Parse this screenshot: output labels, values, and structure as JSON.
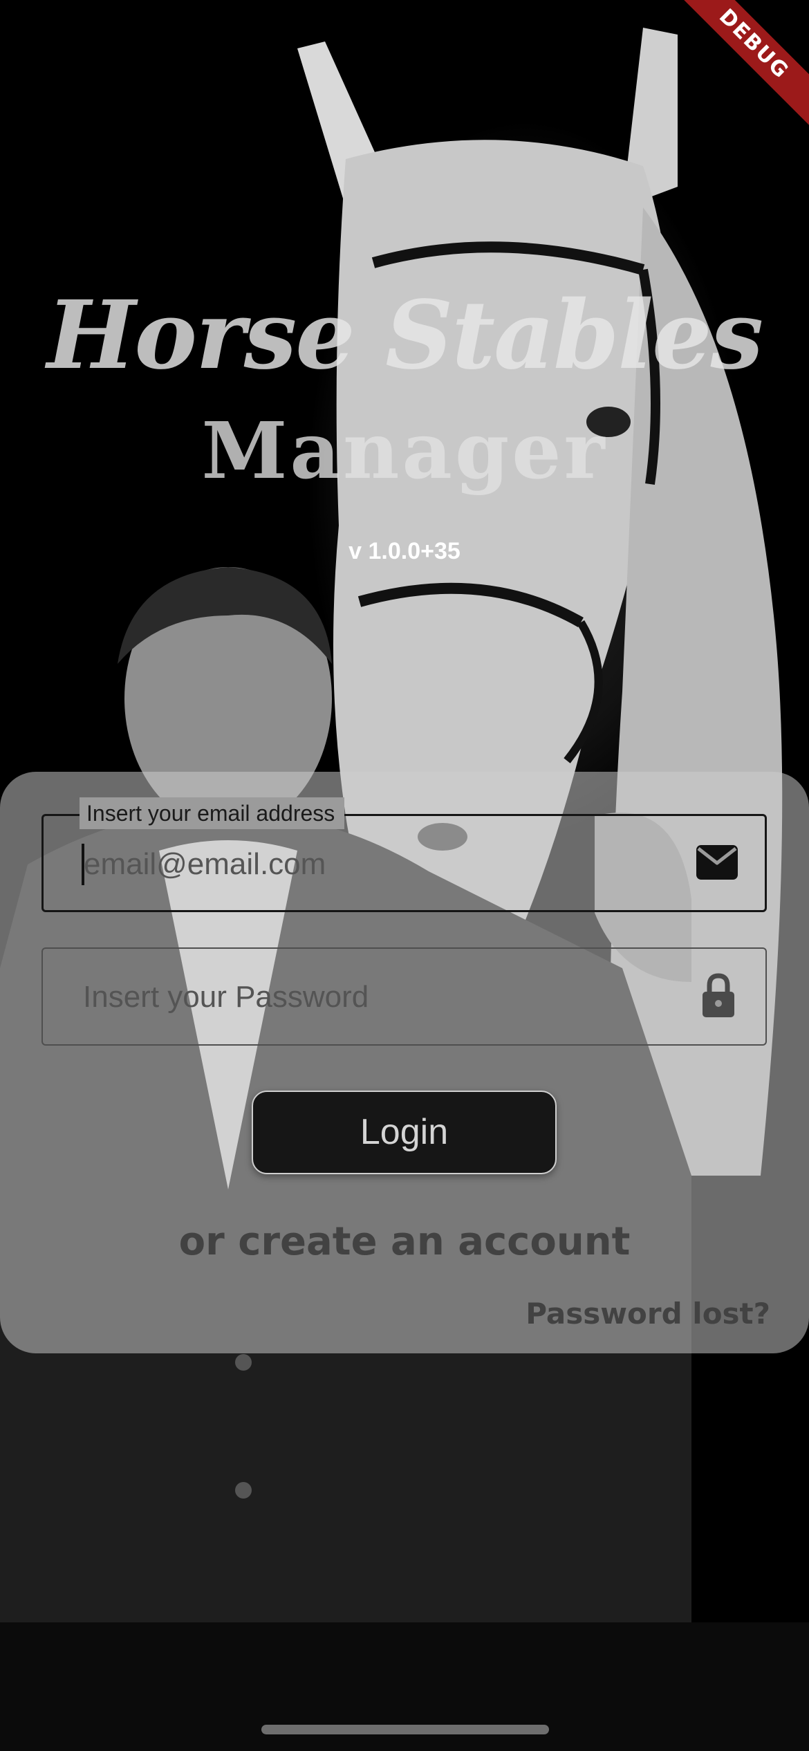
{
  "app": {
    "title_line1": "Horse Stables",
    "title_line2": "Manager",
    "version": "v 1.0.0+35",
    "debug_banner": "DEBUG"
  },
  "login_form": {
    "email": {
      "label": "Insert your email address",
      "placeholder": "email@email.com",
      "icon": "mail-icon"
    },
    "password": {
      "placeholder": "Insert your Password",
      "icon": "lock-icon"
    },
    "login_button": "Login",
    "create_account_link": "or create an account",
    "password_lost_link": "Password lost?"
  },
  "colors": {
    "card_overlay": "#cdcdcd",
    "button_background": "#161616",
    "debug_ribbon": "#9c1a1a",
    "link_text": "#424242"
  }
}
